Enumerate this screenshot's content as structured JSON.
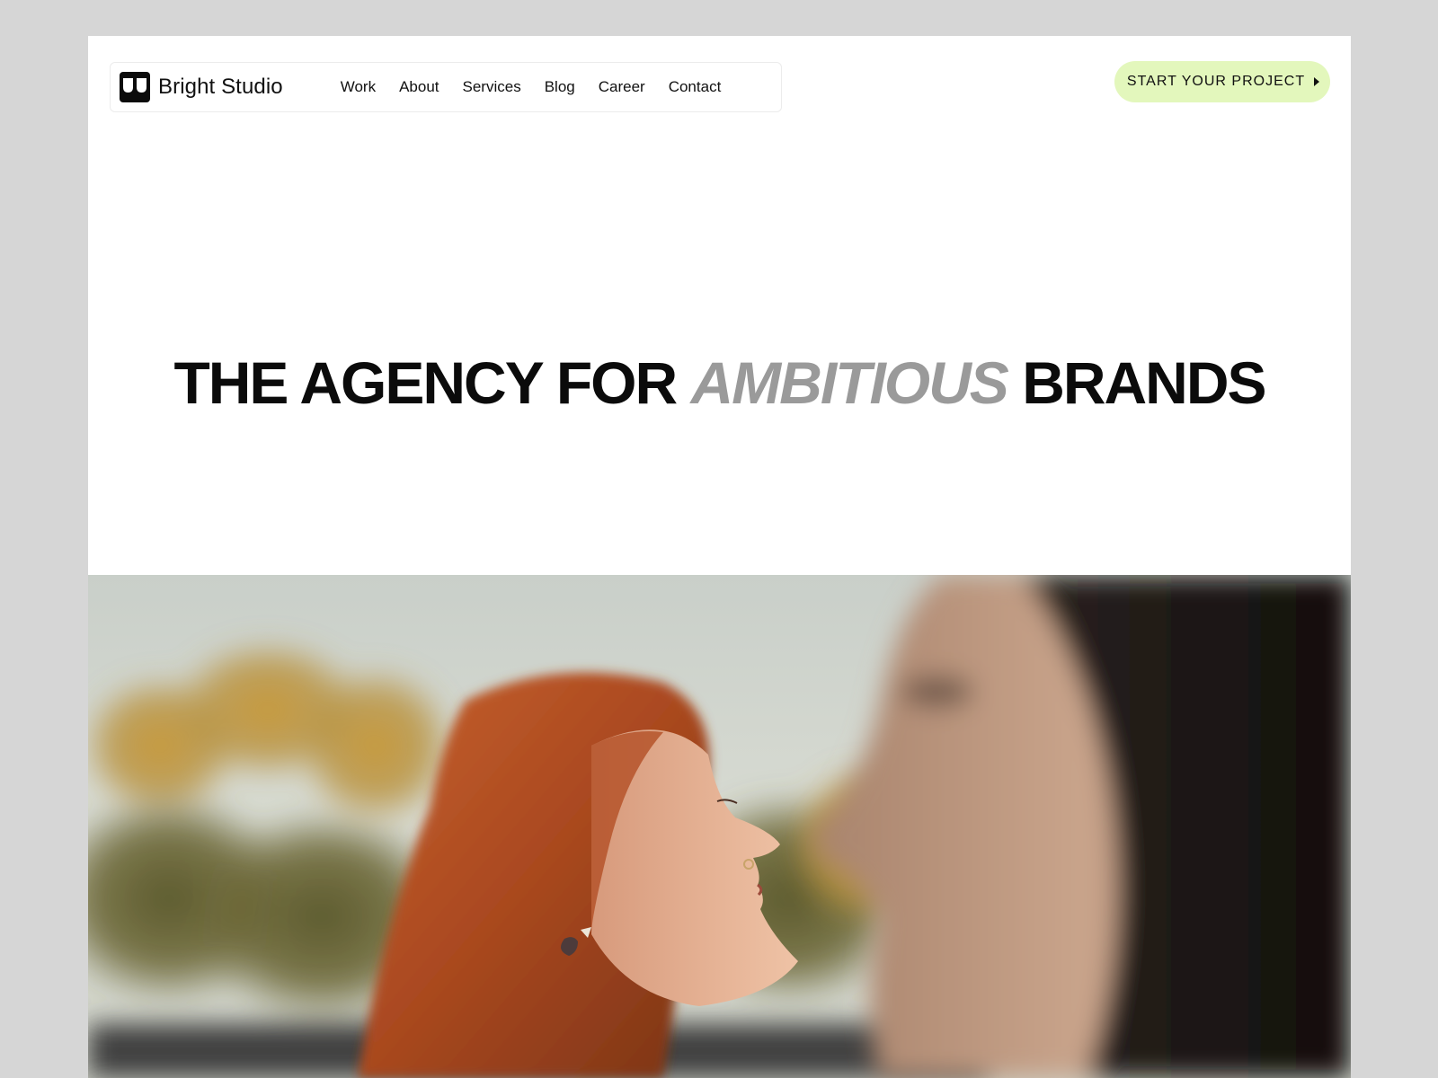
{
  "header": {
    "brand_name": "Bright Studio",
    "nav": [
      {
        "label": "Work"
      },
      {
        "label": "About"
      },
      {
        "label": "Services"
      },
      {
        "label": "Blog"
      },
      {
        "label": "Career"
      },
      {
        "label": "Contact"
      }
    ],
    "cta_label": "START YOUR PROJECT",
    "cta_icon": "caret-right-icon"
  },
  "hero": {
    "title_part1": "THE  AGENCY FOR",
    "title_accent": "AMBITIOUS",
    "title_part2": "BRANDS"
  },
  "colors": {
    "page_background": "#d6d6d6",
    "card_background": "#ffffff",
    "cta_background": "#e3f7bc",
    "headline_accent": "#9a9a9a"
  }
}
